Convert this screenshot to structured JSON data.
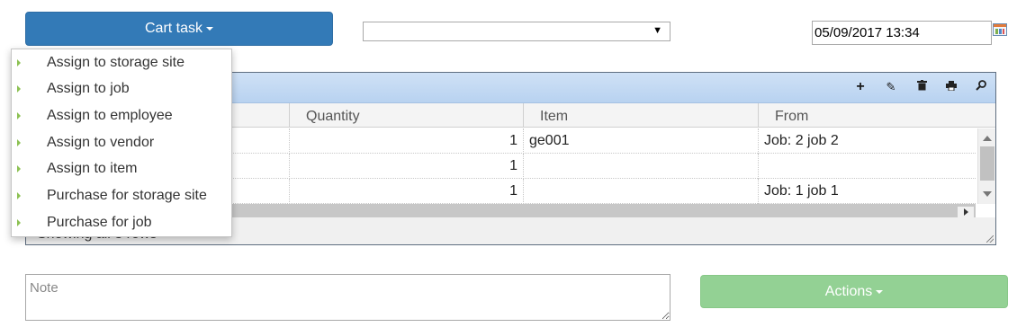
{
  "cart_task": {
    "label": "Cart task",
    "icon": "caret-down-icon"
  },
  "select": {
    "value": "",
    "arrow_icon": "dropdown-arrow-icon"
  },
  "date": {
    "value": "05/09/2017 13:34",
    "icon": "calendar-icon"
  },
  "menu": {
    "items": [
      {
        "label": "Assign to storage site"
      },
      {
        "label": "Assign to job"
      },
      {
        "label": "Assign to employee"
      },
      {
        "label": "Assign to vendor"
      },
      {
        "label": "Assign to item"
      },
      {
        "label": "Purchase for storage site"
      },
      {
        "label": "Purchase for job"
      }
    ]
  },
  "grid": {
    "toolbar_icons": [
      "add-icon",
      "edit-icon",
      "delete-icon",
      "print-icon",
      "search-icon"
    ],
    "columns": [
      "Quantity",
      "Item",
      "From"
    ],
    "rows": [
      {
        "quantity": "1",
        "item": "ge001",
        "from": "Job: 2 job 2"
      },
      {
        "quantity": "1",
        "item": "",
        "from": ""
      },
      {
        "quantity": "1",
        "item": "",
        "from": "Job: 1 job 1"
      }
    ],
    "footer": "Showing all 3 rows"
  },
  "note": {
    "placeholder": "Note",
    "value": ""
  },
  "actions": {
    "label": "Actions",
    "icon": "caret-down-icon"
  },
  "colors": {
    "primary": "#337ab7",
    "success_disabled": "#93d194",
    "toolbar": "#cfe1f6"
  }
}
